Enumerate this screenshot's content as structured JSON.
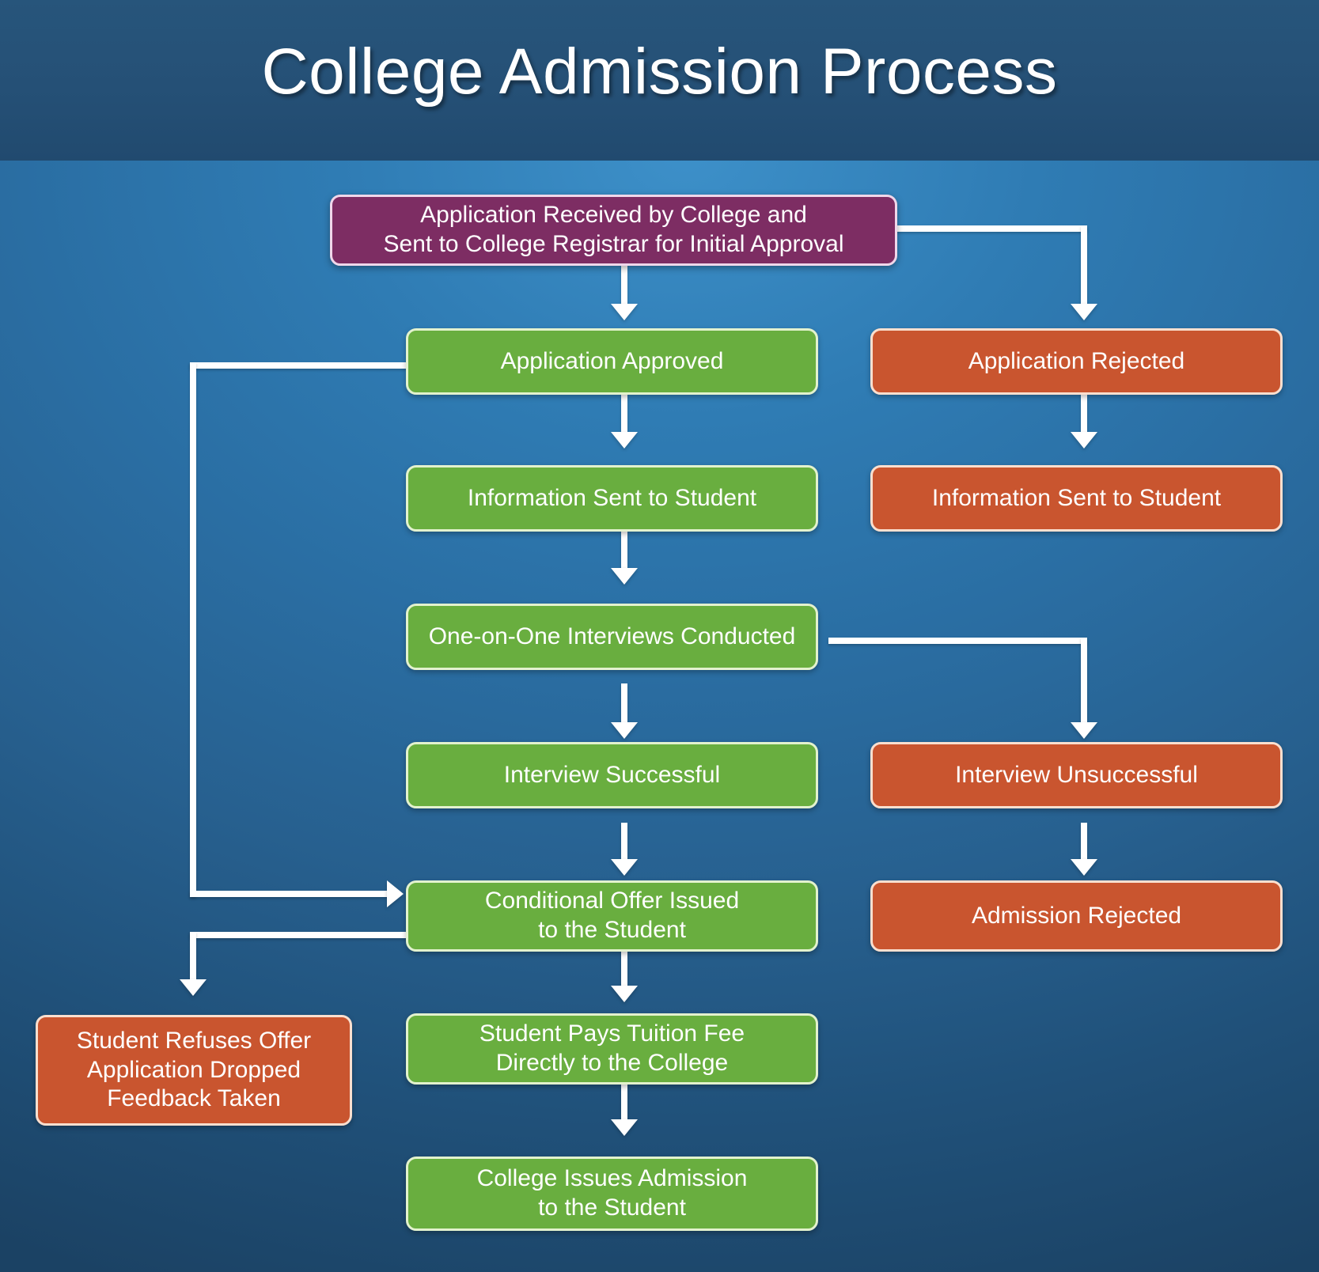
{
  "page": {
    "title": "College Admission Process",
    "type": "flowchart",
    "background_color": "#2a6ea3",
    "header_color": "#27557b"
  },
  "colors": {
    "start_node": "#7d2d63",
    "positive_node": "#69ae3f",
    "negative_node": "#c9552f",
    "connector": "#ffffff",
    "text": "#ffffff"
  },
  "nodes": {
    "application_received": {
      "line1": "Application Received by College and",
      "line2": "Sent to College Registrar for Initial Approval",
      "color": "purple"
    },
    "application_approved": {
      "line1": "Application Approved",
      "color": "green"
    },
    "application_rejected": {
      "line1": "Application Rejected",
      "color": "orange"
    },
    "info_sent_approved": {
      "line1": "Information Sent to Student",
      "color": "green"
    },
    "info_sent_rejected": {
      "line1": "Information Sent to Student",
      "color": "orange"
    },
    "interviews_conducted": {
      "line1": "One-on-One Interviews Conducted",
      "color": "green"
    },
    "interview_successful": {
      "line1": "Interview Successful",
      "color": "green"
    },
    "interview_unsuccessful": {
      "line1": "Interview Unsuccessful",
      "color": "orange"
    },
    "conditional_offer": {
      "line1": "Conditional Offer Issued",
      "line2": "to the Student",
      "color": "green"
    },
    "admission_rejected": {
      "line1": "Admission Rejected",
      "color": "orange"
    },
    "student_refuses": {
      "line1": "Student Refuses Offer",
      "line2": "Application Dropped",
      "line3": "Feedback Taken",
      "color": "orange"
    },
    "tuition_fee": {
      "line1": "Student Pays Tuition Fee",
      "line2": "Directly to the College",
      "color": "green"
    },
    "issues_admission": {
      "line1": "College Issues Admission",
      "line2": "to the Student",
      "color": "green"
    }
  }
}
